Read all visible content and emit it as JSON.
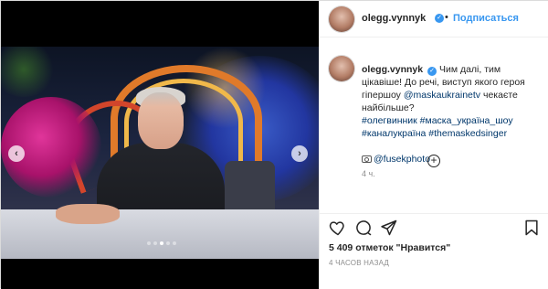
{
  "author": {
    "username": "olegg.vynnyk",
    "verified_mark": "✓",
    "follow_label": "Подписаться",
    "separator": "•"
  },
  "caption": {
    "username": "olegg.vynnyk",
    "text_1": "Чим далі, тим цікавіше! До речі, виступ якого героя гіпершоу",
    "mention_1": "@maskaukrainetv",
    "text_2": "чекаєте найбільше?",
    "hashtags_line_1": "#олегвинник #маска_україна_шоу",
    "hashtags_line_2": "#каналукраїна #themaskedsinger",
    "photo_credit": "@fusekphoto",
    "time_ago": "4 ч."
  },
  "media": {
    "prev_label": "‹",
    "next_label": "›",
    "carousel_total": 5,
    "carousel_active_index": 2
  },
  "more_comments_label": "+",
  "engagement": {
    "likes_text": "5 409 отметок \"Нравится\"",
    "posted_time": "4 ЧАСОВ НАЗАД"
  },
  "icons": {
    "like": "heart-icon",
    "comment": "comment-icon",
    "share": "share-icon",
    "save": "bookmark-icon"
  },
  "colors": {
    "accent": "#3897f0",
    "link": "#00376b",
    "secondary_text": "#8e8e8e"
  }
}
